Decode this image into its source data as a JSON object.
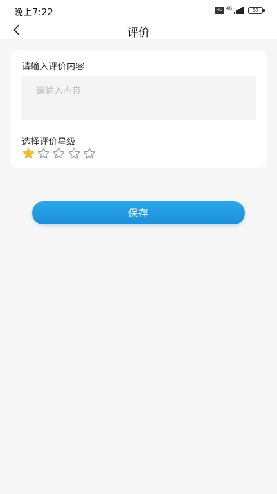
{
  "status_bar": {
    "time": "晚上7:22",
    "hd": "HD",
    "network": "4G",
    "battery": "67"
  },
  "nav": {
    "title": "评价"
  },
  "form": {
    "content_label": "请输入评价内容",
    "content_value": "",
    "content_placeholder": "请输入内容",
    "rating_label": "选择评价星级",
    "rating": 1,
    "rating_max": 5
  },
  "actions": {
    "save_label": "保存"
  },
  "colors": {
    "accent": "#1f94dd",
    "star_filled": "#f5b82e",
    "star_empty": "#9a9a9a",
    "background": "#f6f6f6"
  }
}
